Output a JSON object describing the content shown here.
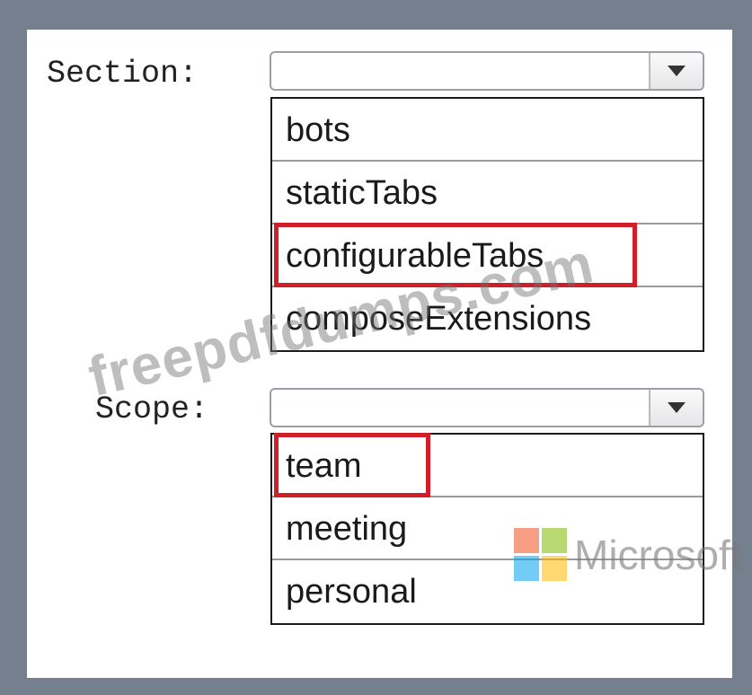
{
  "section": {
    "label": "Section:",
    "selected_value": "",
    "options": [
      "bots",
      "staticTabs",
      "configurableTabs",
      "composeExtensions"
    ],
    "highlighted_option": "configurableTabs"
  },
  "scope": {
    "label": "Scope:",
    "selected_value": "",
    "options": [
      "team",
      "meeting",
      "personal"
    ],
    "highlighted_option": "team"
  },
  "watermark": {
    "text": "freepdfdumps.com",
    "brand": "Microsoft"
  },
  "colors": {
    "frame": "#75808f",
    "highlight": "#d11f2a",
    "ms_red": "#f25022",
    "ms_green": "#7fba00",
    "ms_blue": "#00a4ef",
    "ms_yellow": "#ffb900"
  }
}
